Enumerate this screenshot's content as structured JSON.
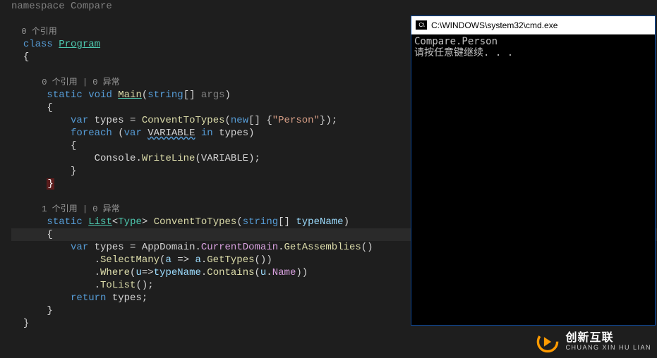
{
  "editor": {
    "namespace_line": "namespace Compare",
    "codelens1": "0 个引用",
    "class_kw": "class",
    "class_name": "Program",
    "codelens2": "0 个引用 | 0 异常",
    "main_sig": {
      "static": "static",
      "void": "void",
      "Main": "Main",
      "paren_open": "(",
      "string": "string",
      "brackets": "[]",
      "args": "args",
      "paren_close": ")"
    },
    "line_var_types": {
      "var": "var",
      "types": "types",
      "eq": " = ",
      "ConventToTypes": "ConventToTypes",
      "open": "(",
      "new": "new",
      "brackets": "[]",
      "space": " ",
      "lb": "{",
      "person": "\"Person\"",
      "rb": "}",
      "close": ")",
      "semi": ";"
    },
    "line_foreach": {
      "foreach": "foreach",
      "open": "(",
      "var": "var",
      "VARIABLE": "VARIABLE",
      "in": "in",
      "types": "types",
      "close": ")"
    },
    "line_console": {
      "Console": "Console",
      "dot": ".",
      "WriteLine": "WriteLine",
      "open": "(",
      "VARIABLE": "VARIABLE",
      "close": ")",
      "semi": ";"
    },
    "codelens3": "1 个引用 | 0 异常",
    "line_convent_sig": {
      "static": "static",
      "List": "List",
      "lt": "<",
      "Type": "Type",
      "gt": ">",
      "ConventToTypes": "ConventToTypes",
      "open": "(",
      "string": "string",
      "brackets": "[]",
      "typeName": "typeName",
      "close": ")"
    },
    "line_appdomain": {
      "var": "var",
      "types": "types",
      "eq": " = ",
      "AppDomain": "AppDomain",
      "dot1": ".",
      "CurrentDomain": "CurrentDomain",
      "dot2": ".",
      "GetAssemblies": "GetAssemblies",
      "parens": "()"
    },
    "line_selectmany": {
      "dot": ".",
      "SelectMany": "SelectMany",
      "open": "(",
      "a": "a",
      "arrow": " => ",
      "a2": "a",
      "dot2": ".",
      "GetTypes": "GetTypes",
      "parens": "()",
      "close": ")"
    },
    "line_where": {
      "dot": ".",
      "Where": "Where",
      "open": "(",
      "u": "u",
      "arrow": "=>",
      "typeName": "typeName",
      "dot2": ".",
      "Contains": "Contains",
      "open2": "(",
      "u2": "u",
      "dot3": ".",
      "Name": "Name",
      "close2": ")",
      "close": ")"
    },
    "line_tolist": {
      "dot": ".",
      "ToList": "ToList",
      "parens": "()",
      "semi": ";"
    },
    "line_return": {
      "return": "return",
      "types": "types",
      "semi": ";"
    }
  },
  "cmd": {
    "title": "C:\\WINDOWS\\system32\\cmd.exe",
    "icon_text": "C:\\",
    "output_line1": "Compare.Person",
    "output_line2": "请按任意键继续. . ."
  },
  "logo": {
    "cn": "创新互联",
    "en": "CHUANG XIN HU LIAN"
  }
}
